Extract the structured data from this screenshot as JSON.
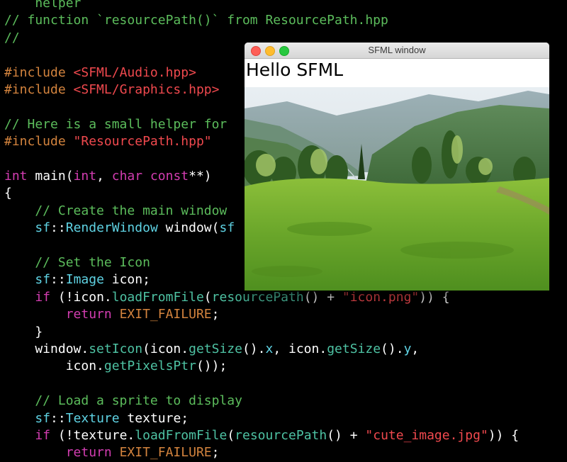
{
  "editor": {
    "lines": [
      {
        "segs": [
          {
            "c": "cm",
            "t": "    helper"
          }
        ]
      },
      {
        "segs": [
          {
            "c": "cm",
            "t": "// function `resourcePath()` from ResourcePath.hpp"
          }
        ]
      },
      {
        "segs": [
          {
            "c": "cm",
            "t": "//"
          }
        ]
      },
      {
        "segs": []
      },
      {
        "segs": [
          {
            "c": "pp",
            "t": "#include "
          },
          {
            "c": "str",
            "t": "<SFML/Audio.hpp>"
          }
        ]
      },
      {
        "segs": [
          {
            "c": "pp",
            "t": "#include "
          },
          {
            "c": "str",
            "t": "<SFML/Graphics.hpp>"
          }
        ]
      },
      {
        "segs": []
      },
      {
        "segs": [
          {
            "c": "cm",
            "t": "// Here is a small helper for"
          }
        ]
      },
      {
        "segs": [
          {
            "c": "pp",
            "t": "#include "
          },
          {
            "c": "str",
            "t": "\"ResourcePath.hpp\""
          }
        ]
      },
      {
        "segs": []
      },
      {
        "segs": [
          {
            "c": "kw",
            "t": "int"
          },
          {
            "c": "pl",
            "t": " main("
          },
          {
            "c": "kw",
            "t": "int"
          },
          {
            "c": "pl",
            "t": ", "
          },
          {
            "c": "kw",
            "t": "char const"
          },
          {
            "c": "pl",
            "t": "**)"
          }
        ]
      },
      {
        "segs": [
          {
            "c": "pl",
            "t": "{"
          }
        ]
      },
      {
        "segs": [
          {
            "c": "cm",
            "t": "    // Create the main window"
          }
        ]
      },
      {
        "segs": [
          {
            "c": "pl",
            "t": "    "
          },
          {
            "c": "tp",
            "t": "sf"
          },
          {
            "c": "pl",
            "t": "::"
          },
          {
            "c": "tp",
            "t": "RenderWindow"
          },
          {
            "c": "pl",
            "t": " window("
          },
          {
            "c": "tp",
            "t": "sf"
          }
        ]
      },
      {
        "segs": []
      },
      {
        "segs": [
          {
            "c": "cm",
            "t": "    // Set the Icon"
          }
        ]
      },
      {
        "segs": [
          {
            "c": "pl",
            "t": "    "
          },
          {
            "c": "tp",
            "t": "sf"
          },
          {
            "c": "pl",
            "t": "::"
          },
          {
            "c": "tp",
            "t": "Image"
          },
          {
            "c": "pl",
            "t": " icon;"
          }
        ]
      },
      {
        "segs": [
          {
            "c": "pl",
            "t": "    "
          },
          {
            "c": "kw",
            "t": "if"
          },
          {
            "c": "pl",
            "t": " (!icon."
          },
          {
            "c": "fn",
            "t": "loadFromFile"
          },
          {
            "c": "pl",
            "t": "("
          },
          {
            "c": "fn",
            "t": "resourcePath"
          },
          {
            "c": "pl",
            "t": "() + "
          },
          {
            "c": "str",
            "t": "\"icon.png\""
          },
          {
            "c": "pl",
            "t": ")) {"
          }
        ]
      },
      {
        "segs": [
          {
            "c": "pl",
            "t": "        "
          },
          {
            "c": "kw",
            "t": "return"
          },
          {
            "c": "pl",
            "t": " "
          },
          {
            "c": "mc",
            "t": "EXIT_FAILURE"
          },
          {
            "c": "pl",
            "t": ";"
          }
        ]
      },
      {
        "segs": [
          {
            "c": "pl",
            "t": "    }"
          }
        ]
      },
      {
        "segs": [
          {
            "c": "pl",
            "t": "    window."
          },
          {
            "c": "fn",
            "t": "setIcon"
          },
          {
            "c": "pl",
            "t": "(icon."
          },
          {
            "c": "fn",
            "t": "getSize"
          },
          {
            "c": "pl",
            "t": "()."
          },
          {
            "c": "tp",
            "t": "x"
          },
          {
            "c": "pl",
            "t": ", icon."
          },
          {
            "c": "fn",
            "t": "getSize"
          },
          {
            "c": "pl",
            "t": "()."
          },
          {
            "c": "tp",
            "t": "y"
          },
          {
            "c": "pl",
            "t": ","
          }
        ]
      },
      {
        "segs": [
          {
            "c": "pl",
            "t": "        icon."
          },
          {
            "c": "fn",
            "t": "getPixelsPtr"
          },
          {
            "c": "pl",
            "t": "());"
          }
        ]
      },
      {
        "segs": []
      },
      {
        "segs": [
          {
            "c": "cm",
            "t": "    // Load a sprite to display"
          }
        ]
      },
      {
        "segs": [
          {
            "c": "pl",
            "t": "    "
          },
          {
            "c": "tp",
            "t": "sf"
          },
          {
            "c": "pl",
            "t": "::"
          },
          {
            "c": "tp",
            "t": "Texture"
          },
          {
            "c": "pl",
            "t": " texture;"
          }
        ]
      },
      {
        "segs": [
          {
            "c": "pl",
            "t": "    "
          },
          {
            "c": "kw",
            "t": "if"
          },
          {
            "c": "pl",
            "t": " (!texture."
          },
          {
            "c": "fn",
            "t": "loadFromFile"
          },
          {
            "c": "pl",
            "t": "("
          },
          {
            "c": "fn",
            "t": "resourcePath"
          },
          {
            "c": "pl",
            "t": "() + "
          },
          {
            "c": "str",
            "t": "\"cute_image.jpg\""
          },
          {
            "c": "pl",
            "t": ")) {"
          }
        ]
      },
      {
        "segs": [
          {
            "c": "pl",
            "t": "        "
          },
          {
            "c": "kw",
            "t": "return"
          },
          {
            "c": "pl",
            "t": " "
          },
          {
            "c": "mc",
            "t": "EXIT_FAILURE"
          },
          {
            "c": "pl",
            "t": ";"
          }
        ]
      }
    ]
  },
  "sfml_window": {
    "title": "SFML window",
    "hello_text": "Hello SFML",
    "sprite_icon": "mountain-landscape-image"
  },
  "colors": {
    "background": "#000000",
    "comment": "#5cbd5c",
    "preprocessor": "#d4843e",
    "string": "#f0494e",
    "keyword": "#d33db1",
    "type": "#5fd3e4",
    "function": "#4ec2a3"
  }
}
